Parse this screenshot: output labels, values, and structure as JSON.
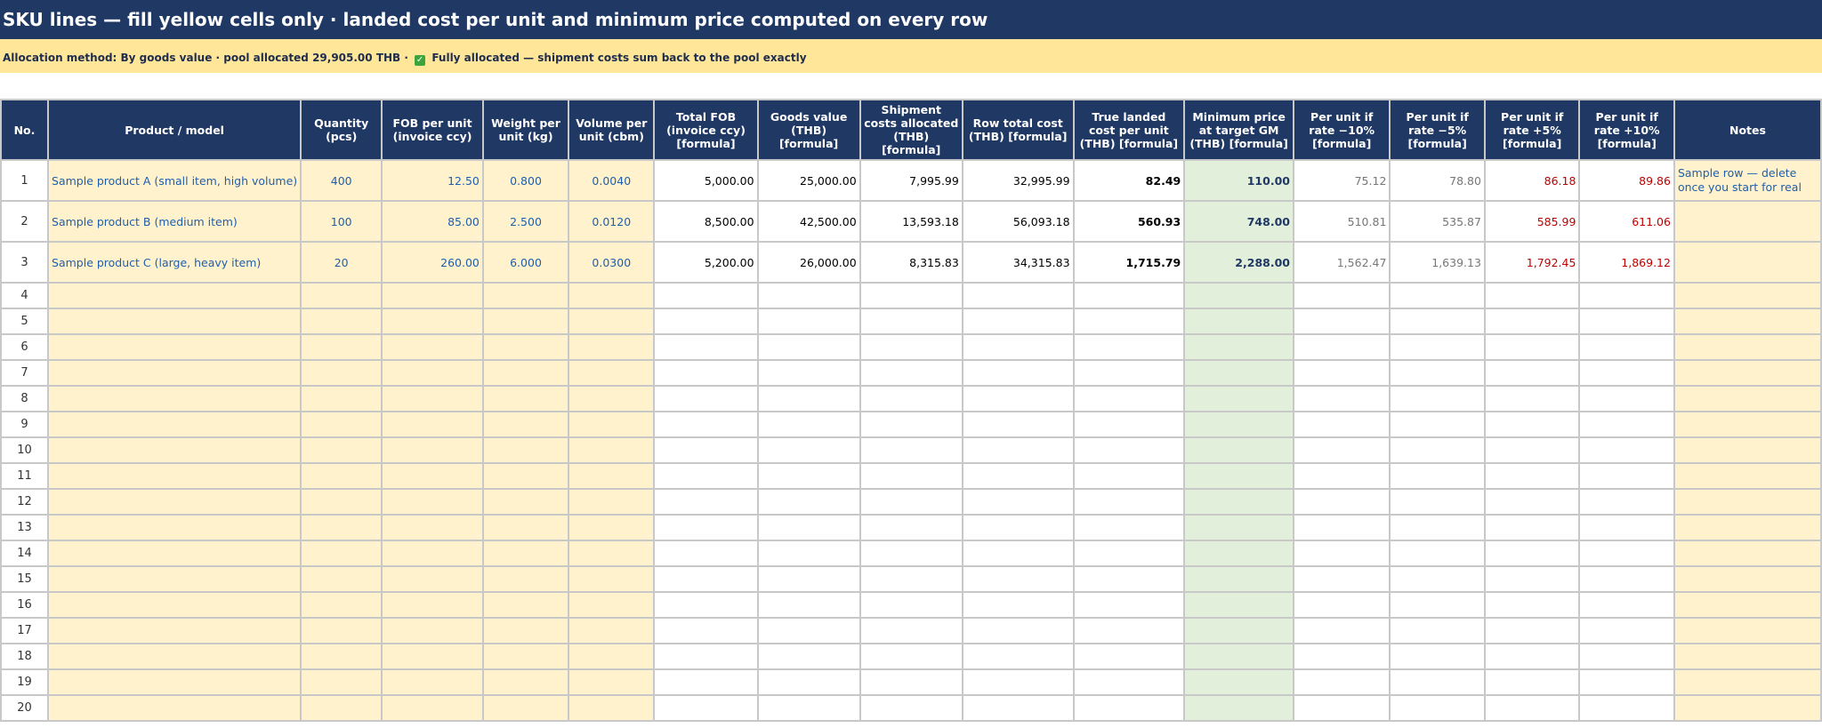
{
  "sheet": {
    "title": "SKU lines — fill yellow cells only · landed cost per unit and minimum price computed on every row",
    "status": {
      "before_check": "Allocation method: By goods value · pool allocated 29,905.00 THB ·",
      "check_icon": "check-mark-icon",
      "after_check": "Fully allocated — shipment costs sum back to the pool exactly"
    }
  },
  "columns": [
    "No.",
    "Product / model",
    "Quantity (pcs)",
    "FOB per unit (invoice ccy)",
    "Weight per unit (kg)",
    "Volume per unit (cbm)",
    "Total FOB (invoice ccy) [formula]",
    "Goods value (THB) [formula]",
    "Shipment costs allocated (THB) [formula]",
    "Row total cost (THB) [formula]",
    "True landed cost per unit (THB) [formula]",
    "Minimum price at target GM (THB) [formula]",
    "Per unit if rate −10% [formula]",
    "Per unit if rate −5% [formula]",
    "Per unit if rate +5% [formula]",
    "Per unit if rate +10% [formula]",
    "Notes"
  ],
  "rows": [
    [
      "1",
      "Sample product A (small item, high volume)",
      "400",
      "12.50",
      "0.800",
      "0.0040",
      "5,000.00",
      "25,000.00",
      "7,995.99",
      "32,995.99",
      "82.49",
      "110.00",
      "75.12",
      "78.80",
      "86.18",
      "89.86",
      "Sample row — delete once you start for real"
    ],
    [
      "2",
      "Sample product B (medium item)",
      "100",
      "85.00",
      "2.500",
      "0.0120",
      "8,500.00",
      "42,500.00",
      "13,593.18",
      "56,093.18",
      "560.93",
      "748.00",
      "510.81",
      "535.87",
      "585.99",
      "611.06",
      ""
    ],
    [
      "3",
      "Sample product C (large, heavy item)",
      "20",
      "260.00",
      "6.000",
      "0.0300",
      "5,200.00",
      "26,000.00",
      "8,315.83",
      "34,315.83",
      "1,715.79",
      "2,288.00",
      "1,562.47",
      "1,639.13",
      "1,792.45",
      "1,869.12",
      ""
    ],
    [
      "4",
      "",
      "",
      "",
      "",
      "",
      "",
      "",
      "",
      "",
      "",
      "",
      "",
      "",
      "",
      "",
      ""
    ],
    [
      "5",
      "",
      "",
      "",
      "",
      "",
      "",
      "",
      "",
      "",
      "",
      "",
      "",
      "",
      "",
      "",
      ""
    ],
    [
      "6",
      "",
      "",
      "",
      "",
      "",
      "",
      "",
      "",
      "",
      "",
      "",
      "",
      "",
      "",
      "",
      ""
    ],
    [
      "7",
      "",
      "",
      "",
      "",
      "",
      "",
      "",
      "",
      "",
      "",
      "",
      "",
      "",
      "",
      "",
      ""
    ],
    [
      "8",
      "",
      "",
      "",
      "",
      "",
      "",
      "",
      "",
      "",
      "",
      "",
      "",
      "",
      "",
      "",
      ""
    ],
    [
      "9",
      "",
      "",
      "",
      "",
      "",
      "",
      "",
      "",
      "",
      "",
      "",
      "",
      "",
      "",
      "",
      ""
    ],
    [
      "10",
      "",
      "",
      "",
      "",
      "",
      "",
      "",
      "",
      "",
      "",
      "",
      "",
      "",
      "",
      "",
      ""
    ],
    [
      "11",
      "",
      "",
      "",
      "",
      "",
      "",
      "",
      "",
      "",
      "",
      "",
      "",
      "",
      "",
      "",
      ""
    ],
    [
      "12",
      "",
      "",
      "",
      "",
      "",
      "",
      "",
      "",
      "",
      "",
      "",
      "",
      "",
      "",
      "",
      ""
    ],
    [
      "13",
      "",
      "",
      "",
      "",
      "",
      "",
      "",
      "",
      "",
      "",
      "",
      "",
      "",
      "",
      "",
      ""
    ],
    [
      "14",
      "",
      "",
      "",
      "",
      "",
      "",
      "",
      "",
      "",
      "",
      "",
      "",
      "",
      "",
      "",
      ""
    ],
    [
      "15",
      "",
      "",
      "",
      "",
      "",
      "",
      "",
      "",
      "",
      "",
      "",
      "",
      "",
      "",
      "",
      ""
    ],
    [
      "16",
      "",
      "",
      "",
      "",
      "",
      "",
      "",
      "",
      "",
      "",
      "",
      "",
      "",
      "",
      "",
      ""
    ],
    [
      "17",
      "",
      "",
      "",
      "",
      "",
      "",
      "",
      "",
      "",
      "",
      "",
      "",
      "",
      "",
      "",
      ""
    ],
    [
      "18",
      "",
      "",
      "",
      "",
      "",
      "",
      "",
      "",
      "",
      "",
      "",
      "",
      "",
      "",
      "",
      ""
    ],
    [
      "19",
      "",
      "",
      "",
      "",
      "",
      "",
      "",
      "",
      "",
      "",
      "",
      "",
      "",
      "",
      "",
      ""
    ],
    [
      "20",
      "",
      "",
      "",
      "",
      "",
      "",
      "",
      "",
      "",
      "",
      "",
      "",
      "",
      "",
      "",
      ""
    ]
  ],
  "colors": {
    "header_bg": "#1f3864",
    "input_cell": "#fff2cc",
    "min_price_cell": "#e2efda",
    "status_bg": "#ffe699",
    "negative_rate_text": "#777777",
    "positive_rate_text": "#c00000",
    "input_text": "#1f5fae"
  }
}
